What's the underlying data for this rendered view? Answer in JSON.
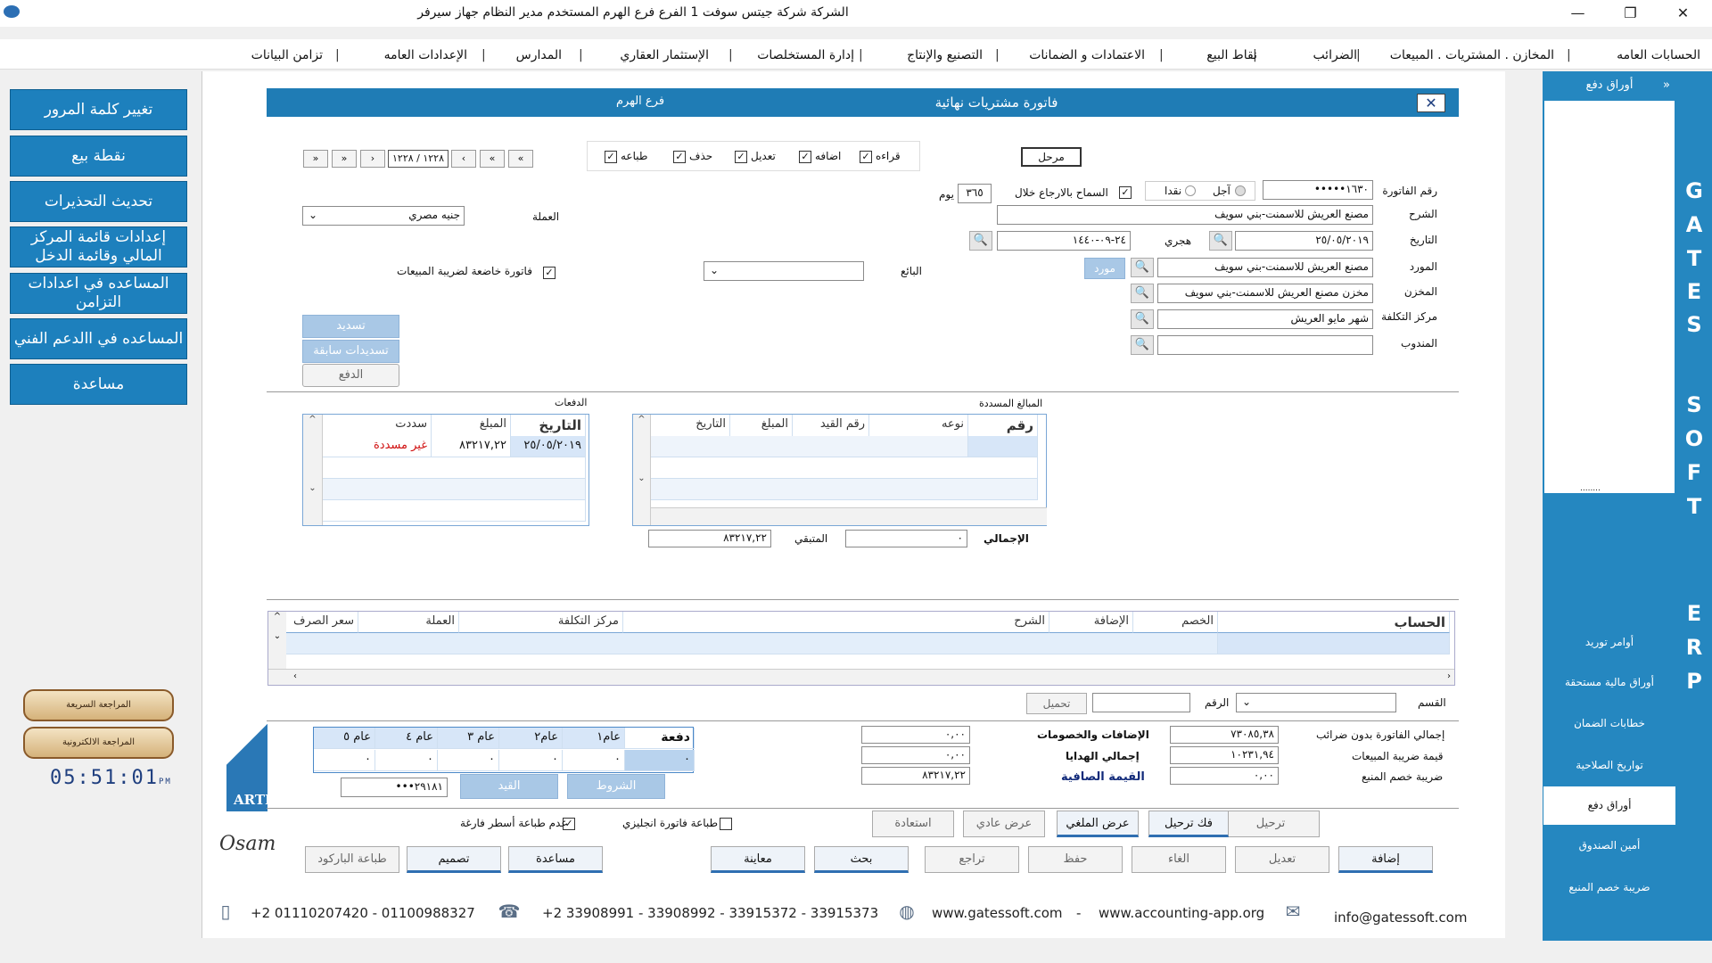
{
  "window": {
    "title": "الشركة شركة جيتس سوفت 1   الفرع فرع الهرم   المستخدم مدير النظام   جهاز سيرفر",
    "min": "—",
    "max": "❐",
    "close": "✕"
  },
  "menu": [
    "الحسابات العامه",
    "المخازن . المشتريات . المبيعات",
    "الضرائب",
    "نقاط البيع",
    "الاعتمادات و الضمانات",
    "التصنيع والإنتاج",
    "إدارة المستخلصات",
    "الإستثمار العقاري",
    "المدارس",
    "الإعدادات العامه",
    "تزامن البيانات"
  ],
  "left_buttons": [
    "تغيير كلمة المرور",
    "نقطة بيع",
    "تحديث التحذيرات",
    "إعدادات قائمة المركز المالي وقائمة الدخل",
    "المساعده في اعدادات التزامن",
    "المساعده في االدعم الفني",
    "مساعدة"
  ],
  "review": {
    "quick": "المراجعة السريعة",
    "electronic": "المراجعة الالكترونية"
  },
  "clock": {
    "time": "05:51:01",
    "ampm": "PM"
  },
  "dialog": {
    "title": "فاتورة مشتريات نهائية",
    "branch": "فرع الهرم",
    "close": "✕"
  },
  "right_panel": {
    "top": "أوراق دفع",
    "collapse": "»",
    "dots": "........",
    "items": [
      "أوامر توريد",
      "أوراق مالية مستحقة",
      "خطابات الضمان",
      "تواريخ الصلاحية",
      "أوراق دفع",
      "أمين الصندوق",
      "ضريبة خصم المنبع"
    ],
    "selected": 4,
    "letters": [
      "G",
      "A",
      "T",
      "E",
      "S",
      "",
      "S",
      "O",
      "F",
      "T",
      "",
      "",
      "E",
      "R",
      "P"
    ]
  },
  "form": {
    "posted_label": "مرحل",
    "perms": [
      "قراءه",
      "اضافه",
      "تعديل",
      "حذف",
      "طباعه"
    ],
    "nav": {
      "first": "«",
      "prev2": "«",
      "prev": "‹",
      "record": "١٢٢٨ / ١٢٢٨",
      "next": "›",
      "next2": "»",
      "last": "»"
    },
    "invoice_no_label": "رقم الفاتورة",
    "invoice_no": "١٦٣٠•••••",
    "credit": "آجل",
    "cash": "نقدا",
    "return_label": "السماح بالارجاع خلال",
    "return_days": "٣٦٥",
    "days_unit": "يوم",
    "desc_label": "الشرح",
    "desc": "مصنع العريش للاسمنت-بني سويف",
    "currency_label": "العملة",
    "currency": "جنيه مصري",
    "date_label": "التاريخ",
    "date": "٢٥/٠٥/٢٠١٩",
    "hijri_label": "هجري",
    "hijri": "٢٤-٠٩-١٤٤٠",
    "supplier_label": "المورد",
    "supplier": "مصنع العريش للاسمنت-بني سويف",
    "supplier_btn": "مورد",
    "seller_label": "البائع",
    "seller": "",
    "tax_label": "فاتورة خاضعة لضريبة المبيعات",
    "store_label": "المخزن",
    "store": "مخزن مصنع العريش للاسمنت-بني سويف",
    "cost_label": "مركز التكلفة",
    "cost": "شهر مايو العريش",
    "rep_label": "المندوب",
    "rep": "",
    "pay_btn": "تسديد",
    "prev_pay_btn": "تسديدات سابقة",
    "payment_btn": "الدفع"
  },
  "paid_grid": {
    "title": "المبالغ المسددة",
    "cols": [
      "رقم",
      "نوعه",
      "رقم القيد",
      "المبلغ",
      "التاريخ"
    ],
    "total_label": "الإجمالي",
    "total": "٠",
    "remain_label": "المتبقي",
    "remain": "٨٣٢١٧,٢٢"
  },
  "payments_grid": {
    "title": "الدفعات",
    "cols": [
      "التاريخ",
      "المبلغ",
      "سددت"
    ],
    "rows": [
      [
        "٢٥/٠٥/٢٠١٩",
        "٨٣٢١٧,٢٢",
        "غير مسددة"
      ]
    ]
  },
  "accounts_grid": {
    "cols": [
      "الحساب",
      "الخصم",
      "الإضافة",
      "الشرح",
      "مركز التكلفة",
      "العملة",
      "سعر الصرف"
    ]
  },
  "section": {
    "dept_label": "القسم",
    "num_label": "الرقم",
    "load_btn": "تحميل"
  },
  "installments": {
    "head": "دفعة",
    "years": [
      "عام١",
      "عام٢",
      "عام ٣",
      "عام ٤",
      "عام ٥"
    ],
    "vals": [
      "٠",
      "٠",
      "٠",
      "٠",
      "٠",
      "٠"
    ],
    "amount": "٢٩١٨١•••",
    "entry_btn": "القيد",
    "terms_btn": "الشروط"
  },
  "totals": {
    "before_tax_label": "إجمالي الفاتورة بدون ضرائب",
    "before_tax": "٧٣٠٨٥,٣٨",
    "vat_label": "قيمة ضريبة المبيعات",
    "vat": "١٠٢٣١,٩٤",
    "wht_label": "ضريبة خصم المنبع",
    "wht": "٠,٠٠",
    "adds_label": "الإضافات والخصومات",
    "adds": "٠,٠٠",
    "gifts_label": "إجمالي الهدايا",
    "gifts": "٠,٠٠",
    "net_label": "القيمة الصافية",
    "net": "٨٣٢١٧,٢٢"
  },
  "print_opts": {
    "no_empty": "عدم طباعة أسطر فارغة",
    "english": "طباعة فاتورة انجليزي"
  },
  "row1": [
    "ترحيل",
    "فك ترحيل",
    "عرض الملغي",
    "عرض عادي",
    "استعادة"
  ],
  "row2": [
    "إضافة",
    "تعديل",
    "الغاء",
    "حفظ",
    "تراجع",
    "بحث",
    "معاينة",
    "مساعدة",
    "تصميم",
    "طباعة الباركود"
  ],
  "brand": {
    "arti": "ARTI",
    "osam": "Osam"
  },
  "footer": {
    "mobile": "+2 01110207420  - 01100988327",
    "phones": "+2 33908991 - 33908992 - 33915372 - 33915373",
    "web1": "www.gatessoft.com",
    "dash": "-",
    "web2": "www.accounting-app.org",
    "email": "info@gatessoft.com"
  }
}
